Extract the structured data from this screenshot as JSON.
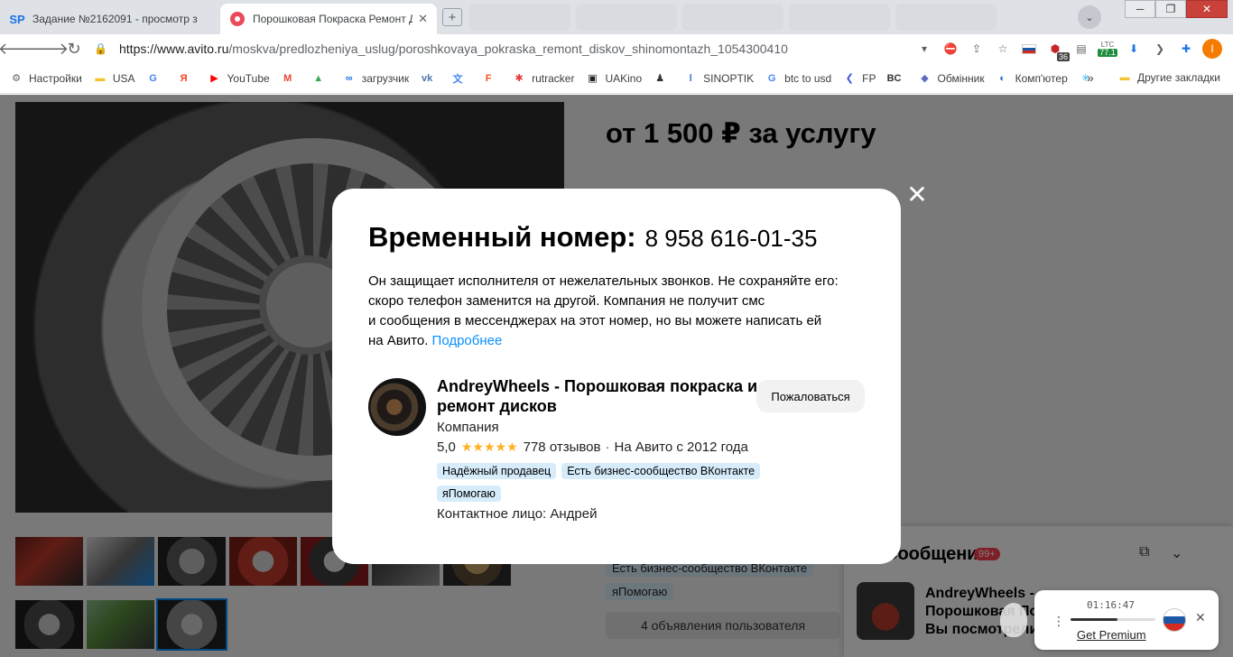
{
  "browser": {
    "tabs": [
      {
        "favicon": "SP",
        "title": "Задание №2162091 - просмотр з",
        "active": false
      },
      {
        "favicon": "avito-icon",
        "title": "Порошковая Покраска Ремонт Д",
        "active": true
      }
    ],
    "url_host": "https://www.avito.ru",
    "url_path": "/moskva/predlozheniya_uslug/poroshkovaya_pokraska_remont_diskov_shinomontazh_1054300410",
    "extensions": {
      "badge_36": "36",
      "ltc_label": "LTC",
      "ltc_value": "77.1",
      "profile_letter": "I"
    },
    "bookmarks": [
      {
        "label": "Настройки",
        "icon": "gear-icon",
        "color": "#5f6368"
      },
      {
        "label": "USA",
        "icon": "folder-icon",
        "color": "#f4c430"
      },
      {
        "label": "",
        "icon": "google-icon",
        "color": "#4285f4"
      },
      {
        "label": "",
        "icon": "yandex-icon",
        "color": "#fc3f1d"
      },
      {
        "label": "YouTube",
        "icon": "youtube-icon",
        "color": "#ff0000"
      },
      {
        "label": "",
        "icon": "gmail-icon",
        "color": "#ea4335"
      },
      {
        "label": "",
        "icon": "drive-icon",
        "color": "#34a853"
      },
      {
        "label": "загрузчик",
        "icon": "infinity-icon",
        "color": "#1a73e8"
      },
      {
        "label": "",
        "icon": "vk-icon",
        "color": "#4a76a8"
      },
      {
        "label": "",
        "icon": "translate-icon",
        "color": "#4285f4"
      },
      {
        "label": "",
        "icon": "f-icon",
        "color": "#f4511e"
      },
      {
        "label": "rutracker",
        "icon": "rutracker-icon",
        "color": "#e53935"
      },
      {
        "label": "UAKino",
        "icon": "uakino-icon",
        "color": "#222222"
      },
      {
        "label": "",
        "icon": "chess-icon",
        "color": "#333333"
      },
      {
        "label": "SINOPTIK",
        "icon": "thermometer-icon",
        "color": "#1e63c6"
      },
      {
        "label": "btc to usd",
        "icon": "google-icon",
        "color": "#4285f4"
      },
      {
        "label": "FP",
        "icon": "fp-icon",
        "color": "#3b5bdb"
      },
      {
        "label": "",
        "icon": "bc-icon",
        "color": "#333333"
      },
      {
        "label": "Обмінник",
        "icon": "diamond-icon",
        "color": "#5c6bc0"
      },
      {
        "label": "Комп'ютер",
        "icon": "ribbon-icon",
        "color": "#1e63c6"
      },
      {
        "label": "",
        "icon": "asterisk-icon",
        "color": "#29b6f6"
      }
    ],
    "bookmarks_more": "»",
    "other_bookmarks": "Другие закладки"
  },
  "page": {
    "price": "от 1 500 ₽ за услугу",
    "thumbnails_count": 10,
    "right_tags": [
      "Есть бизнес-сообщество ВКонтакте",
      "яПомогаю"
    ],
    "ads_button": "4 объявления пользователя",
    "chat": {
      "title": "Сообщения",
      "badge": "99+",
      "item_name": "AndreyWheels -",
      "item_sub": "Порошковая Пок",
      "item_msg": "Вы посмотрели"
    }
  },
  "modal": {
    "label": "Временный номер:",
    "phone": "8 958 616-01-35",
    "desc_1": "Он защищает исполнителя от нежелательных звонков. Не сохраняйте его:",
    "desc_2": "скоро телефон заменится на другой. Компания не получит смс",
    "desc_3": "и сообщения в мессенджерах на этот номер, но вы можете написать ей",
    "desc_4": "на Авито.",
    "link": "Подробнее",
    "seller": {
      "name": "AndreyWheels - Порошковая покраска и ремонт дисков",
      "type": "Компания",
      "rating": "5,0",
      "stars": "★★★★★",
      "reviews": "778 отзывов",
      "since": "На Авито с 2012 года",
      "tags": [
        "Надёжный продавец",
        "Есть бизнес-сообщество ВКонтакте",
        "яПомогаю"
      ],
      "contact": "Контактное лицо: Андрей"
    },
    "complaint_button": "Пожаловаться",
    "close": "✕"
  },
  "premium_widget": {
    "time": "01:16:47",
    "label": "Get Premium",
    "progress": 0.55,
    "menu": "⋮",
    "close": "✕"
  },
  "colors": {
    "accent_link": "#0a8fff",
    "tag_bg": "#d6ecfb",
    "star": "#ffb021",
    "badge_red": "#ff4053"
  }
}
